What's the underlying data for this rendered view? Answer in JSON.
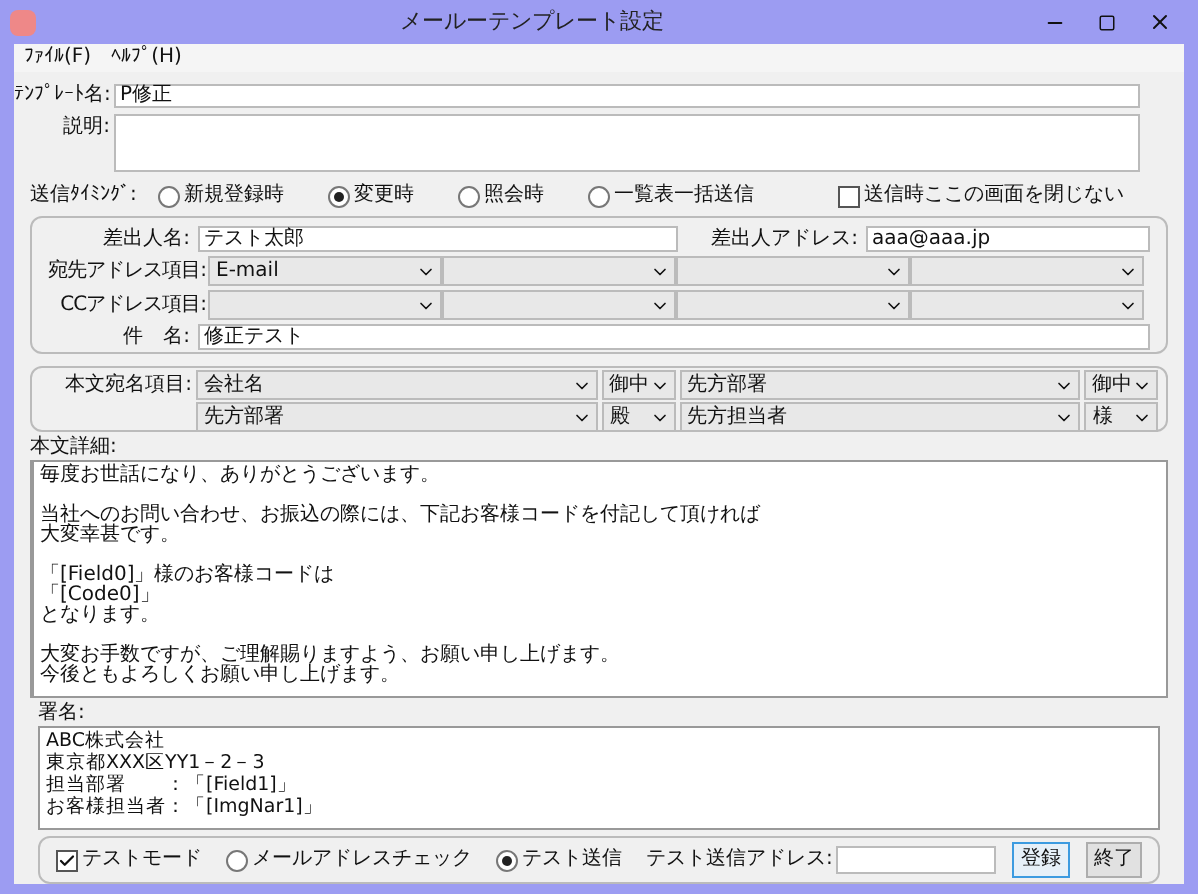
{
  "window": {
    "title": "メールーテンプレート設定"
  },
  "menu": [
    "ﾌｧｲﾙ(F)",
    "ﾍﾙﾌﾟ(H)"
  ],
  "template_name": {
    "label": "ﾃﾝﾌﾟﾚｰﾄ名:",
    "value": "P修正"
  },
  "description": {
    "label": "説明:"
  },
  "timing": {
    "label": "送信ﾀｲﾐﾝｸﾞ:",
    "options": [
      {
        "label": "新規登録時",
        "selected": false
      },
      {
        "label": "変更時",
        "selected": true
      },
      {
        "label": "照会時",
        "selected": false
      },
      {
        "label": "一覧表一括送信",
        "selected": false
      }
    ]
  },
  "keep_open": {
    "label": "送信時ここの画面を閉じない",
    "checked": false
  },
  "sender": {
    "name_label": "差出人名:",
    "name": "テスト太郎",
    "address_label": "差出人アドレス:",
    "address": "aaa@aaa.jp"
  },
  "to_fields": {
    "label": "宛先アドレス項目:",
    "values": [
      "E-mail"
    ]
  },
  "cc_fields": {
    "label": "CCアドレス項目:"
  },
  "subject": {
    "label": "件　名:",
    "value": "修正テスト"
  },
  "salutation": {
    "label": "本文宛名項目:",
    "rows": [
      {
        "items": [
          {
            "value": "会社名"
          },
          {
            "value": "御中"
          },
          {
            "value": "先方部署"
          },
          {
            "value": "御中"
          }
        ]
      },
      {
        "items": [
          {
            "value": "先方部署"
          },
          {
            "value": "殿"
          },
          {
            "value": "先方担当者"
          },
          {
            "value": "様"
          }
        ]
      }
    ]
  },
  "body": {
    "label": "本文詳細:",
    "paragraphs": [
      [
        "毎度お世話になり、ありがとうございます。"
      ],
      [
        "当社へのお問い合わせ、お振込の際には、下記お客様コードを付記して頂ければ",
        "大変幸甚です。"
      ],
      [
        "「[Field0]」様のお客様コードは",
        "「[Code0]」",
        "となります。"
      ],
      [
        "大変お手数ですが、ご理解賜りますよう、お願い申し上げます。",
        "今後ともよろしくお願い申し上げます。"
      ]
    ]
  },
  "signature": {
    "label": "署名:",
    "lines": [
      "ABC株式会社",
      "東京都XXX区YY1－2－3",
      "担当部署　　：「[Field1]」",
      "お客様担当者：「[ImgNar1]」"
    ]
  },
  "test_mode": {
    "label": "テストモード",
    "checked": true
  },
  "send_mode": [
    {
      "label": "メールアドレスチェック",
      "selected": false
    },
    {
      "label": "テスト送信",
      "selected": true
    }
  ],
  "test_address": {
    "label": "テスト送信アドレス:"
  },
  "buttons": [
    {
      "label": "登録",
      "kind": "default"
    },
    {
      "label": "終了",
      "kind": "normal"
    }
  ]
}
